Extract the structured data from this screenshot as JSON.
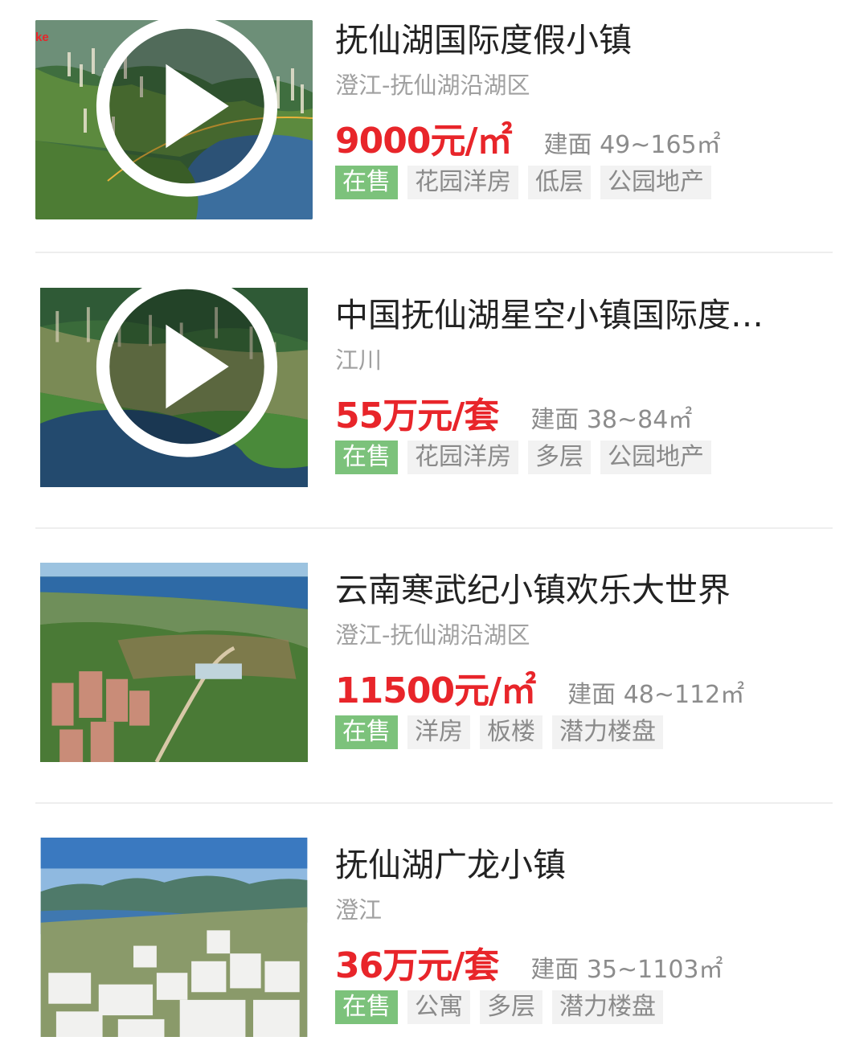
{
  "listings": [
    {
      "title": "抚仙湖国际度假小镇",
      "location": "澄江-抚仙湖沿湖区",
      "price": "9000元/㎡",
      "area": "建面 49~165㎡",
      "status_tag": "在售",
      "tags": [
        "花园洋房",
        "低层",
        "公园地产"
      ],
      "has_video": true,
      "thumb_text": "ke"
    },
    {
      "title": "中国抚仙湖星空小镇国际度…",
      "location": "江川",
      "price": "55万元/套",
      "area": "建面 38~84㎡",
      "status_tag": "在售",
      "tags": [
        "花园洋房",
        "多层",
        "公园地产"
      ],
      "has_video": true
    },
    {
      "title": "云南寒武纪小镇欢乐大世界",
      "location": "澄江-抚仙湖沿湖区",
      "price": "11500元/㎡",
      "area": "建面 48~112㎡",
      "status_tag": "在售",
      "tags": [
        "洋房",
        "板楼",
        "潜力楼盘"
      ],
      "has_video": false
    },
    {
      "title": "抚仙湖广龙小镇",
      "location": "澄江",
      "price": "36万元/套",
      "area": "建面 35~1103㎡",
      "status_tag": "在售",
      "tags": [
        "公寓",
        "多层",
        "潜力楼盘"
      ],
      "has_video": false
    }
  ],
  "colors": {
    "price": "#e8252a",
    "status_tag_bg": "#7cc27b",
    "tag_bg": "#f2f2f2"
  },
  "icons": {
    "video": "play-icon"
  }
}
